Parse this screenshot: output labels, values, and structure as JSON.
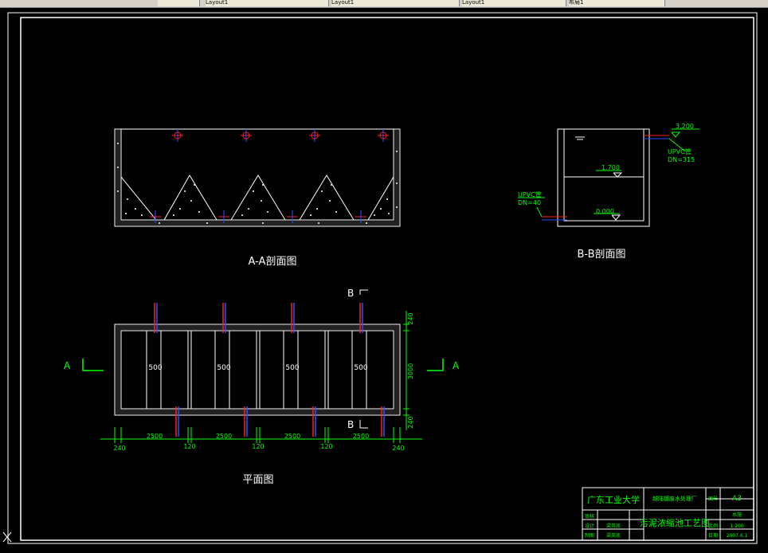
{
  "tabs": [
    "Layout1",
    "Layout1",
    "Layout1",
    "Layout1",
    "布局1"
  ],
  "colors": {
    "background": "#000000",
    "line": "#ffffff",
    "dimension": "#00ff00",
    "pipe_red": "#ff2020",
    "pipe_blue": "#3050ff"
  },
  "section_aa": {
    "title": "A-A剖面图"
  },
  "section_bb": {
    "title": "B-B剖面图",
    "elev_top": "3.200",
    "elev_mid": "1.700",
    "elev_bottom": "0.000",
    "pipe_out_1": "UPVC管",
    "pipe_out_2": "DN=315",
    "pipe_in_1": "UPVC管",
    "pipe_in_2": "DN=40"
  },
  "plan": {
    "title": "平面图",
    "cell_width_label": "500",
    "section_mark_a": "A",
    "section_mark_b": "B",
    "dims_right": [
      "240",
      "3000",
      "240"
    ],
    "dims_bottom_main": [
      "2500",
      "2500",
      "2500",
      "2500"
    ],
    "dims_bottom_sub": [
      "240",
      "120",
      "120",
      "120",
      "240"
    ]
  },
  "title_block": {
    "school": "广东工业大学",
    "project": "越陆镀废水处理厂",
    "size_label": "图号",
    "size_value": "A3",
    "drawing_name": "污泥浓缩池工艺图",
    "row_labels": [
      "审核",
      "设计",
      "制图"
    ],
    "row_names": [
      "",
      "梁英凯",
      "梁英凯"
    ],
    "right_labels": [
      "",
      "比例",
      "日期"
    ],
    "right_values": [
      "水施",
      "1:200",
      "2007.6.1"
    ]
  }
}
